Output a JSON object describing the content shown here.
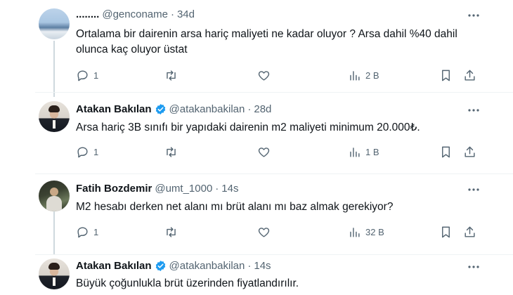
{
  "tweets": [
    {
      "name": "........",
      "handle": "@genconame",
      "sep": "·",
      "time": "34d",
      "verified": false,
      "text": "Ortalama bir dairenin arsa hariç maliyeti ne kadar oluyor ? Arsa dahil %40 dahil olunca kaç oluyor üstat",
      "replies": "1",
      "retweets": "",
      "likes": "",
      "views": "2 B"
    },
    {
      "name": "Atakan Bakılan",
      "handle": "@atakanbakilan",
      "sep": "·",
      "time": "28d",
      "verified": true,
      "text": "Arsa hariç 3B sınıfı bir yapıdaki dairenin m2 maliyeti minimum 20.000₺.",
      "replies": "1",
      "retweets": "",
      "likes": "",
      "views": "1 B"
    },
    {
      "name": "Fatih Bozdemir",
      "handle": "@umt_1000",
      "sep": "·",
      "time": "14s",
      "verified": false,
      "text": "M2 hesabı derken net alanı mı brüt alanı mı baz almak gerekiyor?",
      "replies": "1",
      "retweets": "",
      "likes": "",
      "views": "32 B"
    },
    {
      "name": "Atakan Bakılan",
      "handle": "@atakanbakilan",
      "sep": "·",
      "time": "14s",
      "verified": true,
      "text": "Büyük çoğunlukla brüt üzerinden fiyatlandırılır."
    }
  ],
  "colors": {
    "text": "#0f1419",
    "muted": "#536471",
    "verified": "#1d9bf0",
    "thread_line": "#cfd9de"
  },
  "icons": [
    "reply-icon",
    "retweet-icon",
    "like-icon",
    "views-icon",
    "bookmark-icon",
    "share-icon",
    "more-icon",
    "verified-badge-icon"
  ]
}
